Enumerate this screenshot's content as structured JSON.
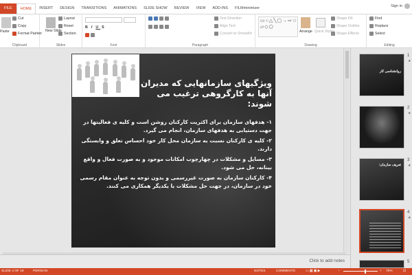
{
  "tabs": [
    "FILE",
    "HOME",
    "INSERT",
    "DESIGN",
    "TRANSITIONS",
    "ANIMATIONS",
    "SLIDE SHOW",
    "REVIEW",
    "VIEW",
    "ADD-INS",
    "FILMminimizer"
  ],
  "active_tab": "HOME",
  "account": {
    "sign_in": "Sign in"
  },
  "ribbon": {
    "clipboard": {
      "label": "Clipboard",
      "paste": "Paste",
      "cut": "Cut",
      "copy": "Copy",
      "format_painter": "Format Painter"
    },
    "slides": {
      "label": "Slides",
      "new_slide": "New Slide",
      "layout": "Layout",
      "reset": "Reset",
      "section": "Section"
    },
    "font": {
      "label": "Font"
    },
    "paragraph": {
      "label": "Paragraph",
      "text_direction": "Text Direction",
      "align_text": "Align Text",
      "convert_smartart": "Convert to SmartArt"
    },
    "drawing": {
      "label": "Drawing",
      "arrange": "Arrange",
      "quick_styles": "Quick Styles",
      "shape_fill": "Shape Fill",
      "shape_outline": "Shape Outline",
      "shape_effects": "Shape Effects"
    },
    "editing": {
      "label": "Editing",
      "find": "Find",
      "replace": "Replace",
      "select": "Select"
    }
  },
  "slide": {
    "title": "ویژگیهای سازمانهایی که مدیران آنها به کارگروهی ترغیب می شوند:",
    "points": [
      "۱- هدفهای سازمان برای اکثریت کارکنان روشن است و کلیه ی فعالیتها در جهت دستیابی به هدفهای سازمان، انجام می گیرد.",
      "۲- کلیه ی کارکنان نسبت به سازمان محل کار خود احساس تعلق و وابستگی دارند.",
      "۳- مسایل و مشکلات در چهارچوب امکانات موجود و به صورت فعال و واقع بینانه، حل می شود.",
      "۴- کارکنان سازمان به صورت غیررسمی و بدون توجه به عنوان مقام رسمی خود در سازمان، در جهت حل مشکلات با یکدیگر همکاری می کنند."
    ]
  },
  "notes_placeholder": "Click to add notes",
  "thumbnails": [
    {
      "number": "1",
      "title": "روانشناسی کار"
    },
    {
      "number": "2",
      "title": ""
    },
    {
      "number": "3",
      "title": "تعریف سازمان:"
    },
    {
      "number": "4",
      "title": ""
    },
    {
      "number": "5",
      "title": ""
    }
  ],
  "status": {
    "slide_info": "SLIDE 4 OF 19",
    "language": "PERSIAN",
    "notes": "NOTES",
    "comments": "COMMENTS",
    "zoom": "70%",
    "zoom_level_fraction": 0.7
  },
  "colors": {
    "accent": "#d24726",
    "slide_bg": "#2a2a2a",
    "slide_text": "#ffffff"
  }
}
